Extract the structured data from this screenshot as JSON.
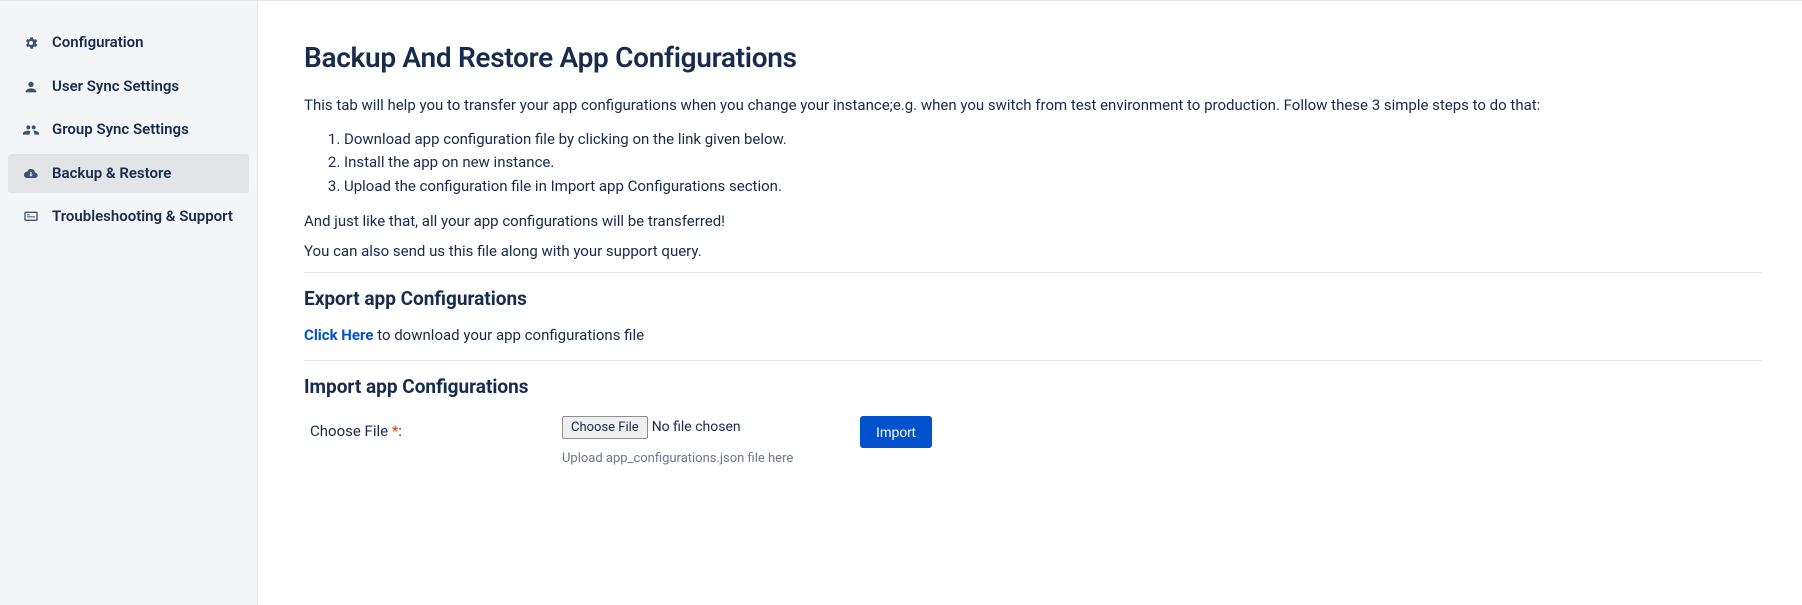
{
  "sidebar": {
    "items": [
      {
        "label": "Configuration"
      },
      {
        "label": "User Sync Settings"
      },
      {
        "label": "Group Sync Settings"
      },
      {
        "label": "Backup & Restore"
      },
      {
        "label": "Troubleshooting & Support"
      }
    ]
  },
  "main": {
    "title": "Backup And Restore App Configurations",
    "intro": "This tab will help you to transfer your app configurations when you change your instance;e.g. when you switch from test environment to production. Follow these 3 simple steps to do that:",
    "steps": [
      "Download app configuration file by clicking on the link given below.",
      "Install the app on new instance.",
      "Upload the configuration file in Import app Configurations section."
    ],
    "outro1": "And just like that, all your app configurations will be transferred!",
    "outro2": "You can also send us this file along with your support query.",
    "export": {
      "heading": "Export app Configurations",
      "link_text": "Click Here",
      "suffix": " to download your app configurations file"
    },
    "import": {
      "heading": "Import app Configurations",
      "label": "Choose File ",
      "required": "*",
      "colon": ":",
      "choose_button": "Choose File",
      "file_status": "No file chosen",
      "hint": "Upload app_configurations.json file here",
      "button": "Import"
    }
  }
}
